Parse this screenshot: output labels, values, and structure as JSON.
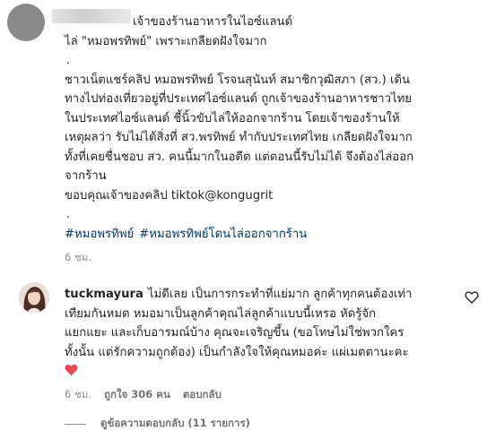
{
  "post": {
    "lines": [
      "เจ้าของร้านอาหารในไอซ์แลนด์",
      "ไล่ \"หมอพรทิพย์\" เพราะเกลียดฝังใจมาก",
      ".",
      "ชาวเน็ตแชร์คลิป หมอพรทิพย์ โรจนสุนันท์ สมาชิกวุฒิสภา (สว.) เดิน",
      "ทางไปท่องเที่ยวอยู่ที่ประเทศไอซ์แลนด์ ถูกเจ้าของร้านอาหารชาวไทย",
      "ในประเทศไอซ์แลนด์ ชี้นิ้วขับไล่ให้ออกจากร้าน โดยเจ้าของร้านให้",
      "เหตุผลว่า รับไม่ได้สิ่งที่ สว.พรทิพย์ ทำกับประเทศไทย เกลียดฝังใจมาก",
      "ทั้งที่เคยชื่นชอบ สว. คนนี้มากในอดีต แต่ตอนนี้รับไม่ได้ จึงต้องไล่ออก",
      "จากร้าน",
      "ขอบคุณเจ้าของคลิป tiktok@kongugrit",
      "."
    ],
    "hashtags": [
      "#หมอพรทิพย์",
      "#หมอพรทิพย์โดนไล่ออกจากร้าน"
    ],
    "time": "6 ชม."
  },
  "comment": {
    "username": "tuckmayura",
    "first_line": "ไม่ดีเลย เป็นการกระทำที่แย่มาก ลูกค้าทุกคนต้องเท่า",
    "lines": [
      "เทียมกันหมด หมอมาเป็นลูกค้าคุณไล่ลูกค้าแบบนี้เหรอ หัดรู้จัก",
      "แยกแยะ และเก็บอารมณ์บ้าง คุณจะเจริญขึ้น (ขอโทษไม่ใช่พวกใคร",
      "ทั้งนั้น แต่รักความถูกต้อง) เป็นกำลังใจให้คุณหมอค่ะ แผ่เมตตานะคะ"
    ],
    "time": "6 ชม.",
    "likes": "ถูกใจ 306 คน",
    "reply": "ตอบกลับ",
    "view_replies": "ดูข้อความตอบกลับ (11 รายการ)"
  },
  "icons": {
    "heart": "heart-icon",
    "like": "heart-outline-icon"
  },
  "colors": {
    "heart_red": "#ed4956",
    "hashtag": "#00376b",
    "meta": "#8e8e8e"
  }
}
